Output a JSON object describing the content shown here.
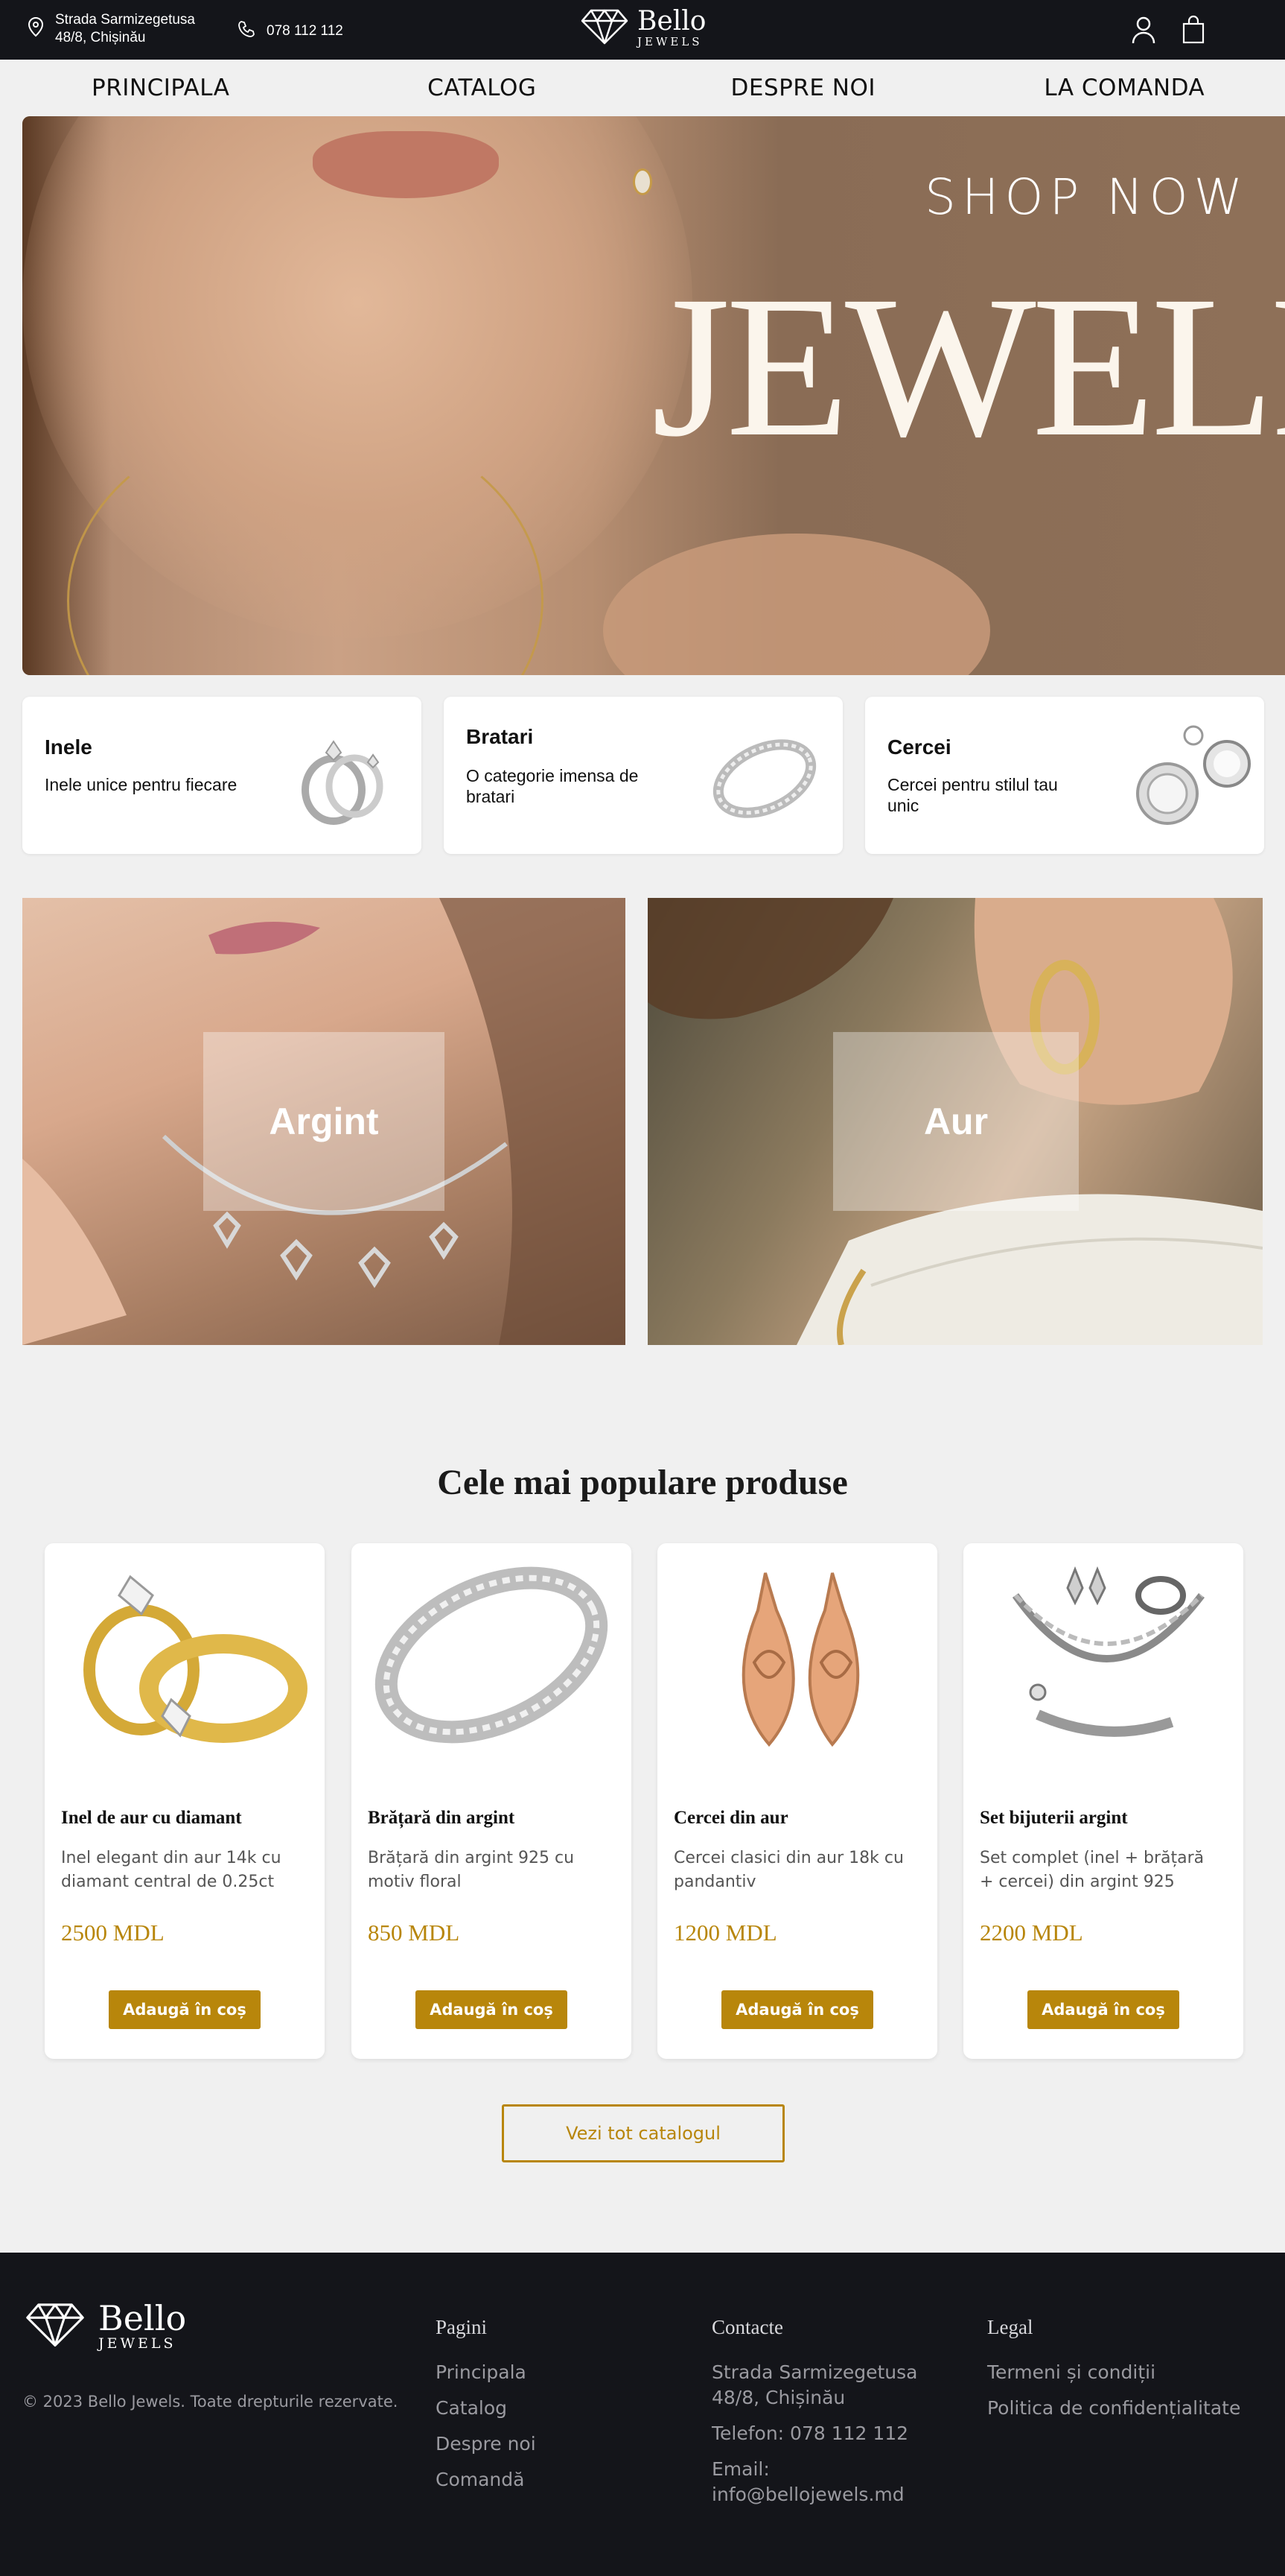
{
  "header": {
    "address": "Strada Sarmizegetusa 48/8, Chișinău",
    "phone": "078 112 112",
    "logo_main": "Bello",
    "logo_sub": "JEWELS",
    "icons": {
      "location": "location-pin-icon",
      "phone": "phone-icon",
      "user": "user-icon",
      "cart": "shopping-bag-icon"
    }
  },
  "nav": {
    "items": [
      "PRINCIPALA",
      "CATALOG",
      "DESPRE NOI",
      "LA COMANDA"
    ]
  },
  "hero": {
    "shop_now": "SHOP NOW",
    "headline": "JEWELRY"
  },
  "categories": [
    {
      "title": "Inele",
      "subtitle": "Inele unice pentru fiecare"
    },
    {
      "title": "Bratari",
      "subtitle": "O categorie imensa de bratari"
    },
    {
      "title": "Cercei",
      "subtitle": "Cercei pentru stilul tau unic"
    }
  ],
  "banners": [
    {
      "label": "Argint"
    },
    {
      "label": "Aur"
    }
  ],
  "popular": {
    "title": "Cele mai populare produse",
    "products": [
      {
        "name": "Inel de aur cu diamant",
        "description": "Inel elegant din aur 14k cu diamant central de 0.25ct",
        "price": "2500 MDL",
        "button": "Adaugă în coș"
      },
      {
        "name": "Brățară din argint",
        "description": "Brățară din argint 925 cu motiv floral",
        "price": "850 MDL",
        "button": "Adaugă în coș"
      },
      {
        "name": "Cercei din aur",
        "description": "Cercei clasici din aur 18k cu pandantiv",
        "price": "1200 MDL",
        "button": "Adaugă în coș"
      },
      {
        "name": "Set bijuterii argint",
        "description": "Set complet (inel + brățară + cercei) din argint 925",
        "price": "2200 MDL",
        "button": "Adaugă în coș"
      }
    ],
    "catalog_button": "Vezi tot catalogul"
  },
  "footer": {
    "logo_main": "Bello",
    "logo_sub": "JEWELS",
    "copyright": "© 2023 Bello Jewels. Toate drepturile rezervate.",
    "pages": {
      "title": "Pagini",
      "links": [
        "Principala",
        "Catalog",
        "Despre noi",
        "Comandă"
      ]
    },
    "contacts": {
      "title": "Contacte",
      "lines": [
        "Strada Sarmizegetusa 48/8, Chișinău",
        "Telefon: 078 112 112",
        "Email: info@bellojewels.md"
      ]
    },
    "legal": {
      "title": "Legal",
      "links": [
        "Termeni și condiții",
        "Politica de confidențialitate"
      ]
    }
  },
  "colors": {
    "accent": "#b8860b",
    "dark": "#14151a",
    "background": "#f0f0f0"
  }
}
